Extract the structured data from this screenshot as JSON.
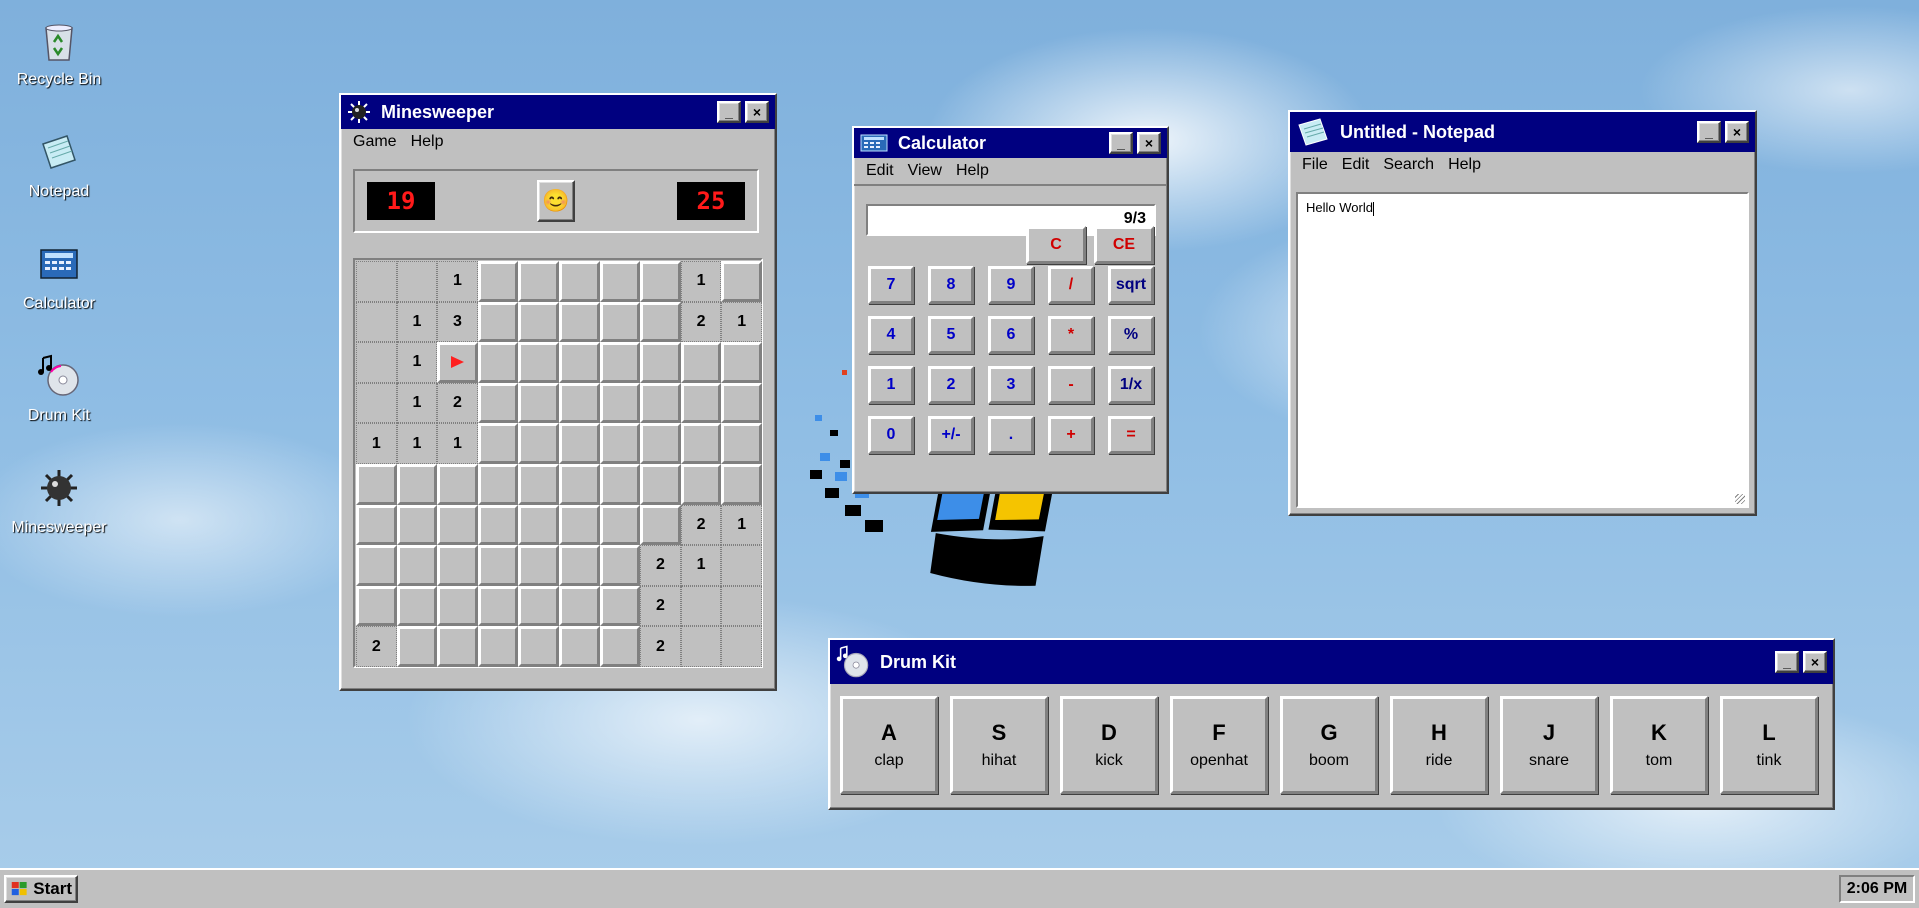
{
  "desktop": {
    "icons": [
      {
        "label": "Recycle Bin",
        "icon": "recycle-bin-icon"
      },
      {
        "label": "Notepad",
        "icon": "notepad-icon"
      },
      {
        "label": "Calculator",
        "icon": "calculator-icon"
      },
      {
        "label": "Drum Kit",
        "icon": "drum-kit-icon"
      },
      {
        "label": "Minesweeper",
        "icon": "minesweeper-icon"
      }
    ]
  },
  "minesweeper": {
    "title": "Minesweeper",
    "menu": [
      "Game",
      "Help"
    ],
    "mines_left": "19",
    "timer": "25",
    "face": "😊",
    "board": [
      [
        "o",
        "o",
        "1",
        "c",
        "c",
        "c",
        "c",
        "c",
        "1",
        "c"
      ],
      [
        "o",
        "1",
        "3",
        "c",
        "c",
        "c",
        "c",
        "c",
        "2",
        "1"
      ],
      [
        "o",
        "1",
        "F",
        "c",
        "c",
        "c",
        "c",
        "c",
        "c",
        "c"
      ],
      [
        "o",
        "1",
        "2",
        "c",
        "c",
        "c",
        "c",
        "c",
        "c",
        "c"
      ],
      [
        "1",
        "1",
        "1",
        "c",
        "c",
        "c",
        "c",
        "c",
        "c",
        "c"
      ],
      [
        "c",
        "c",
        "c",
        "c",
        "c",
        "c",
        "c",
        "c",
        "c",
        "c"
      ],
      [
        "c",
        "c",
        "c",
        "c",
        "c",
        "c",
        "c",
        "c",
        "2",
        "1"
      ],
      [
        "c",
        "c",
        "c",
        "c",
        "c",
        "c",
        "c",
        "2",
        "1",
        "o"
      ],
      [
        "c",
        "c",
        "c",
        "c",
        "c",
        "c",
        "c",
        "2",
        "o",
        "o"
      ],
      [
        "2",
        "c",
        "c",
        "c",
        "c",
        "c",
        "c",
        "2",
        "o",
        "o"
      ]
    ]
  },
  "calculator": {
    "title": "Calculator",
    "menu": [
      "Edit",
      "View",
      "Help"
    ],
    "display": "9/3",
    "clear_label": "C",
    "clear_entry_label": "CE",
    "rows": [
      [
        "7",
        "8",
        "9",
        "/",
        "sqrt"
      ],
      [
        "4",
        "5",
        "6",
        "*",
        "%"
      ],
      [
        "1",
        "2",
        "3",
        "-",
        "1/x"
      ],
      [
        "0",
        "+/-",
        ".",
        "+",
        "="
      ]
    ]
  },
  "notepad": {
    "title": "Untitled - Notepad",
    "menu": [
      "File",
      "Edit",
      "Search",
      "Help"
    ],
    "text": "Hello World"
  },
  "drumkit": {
    "title": "Drum Kit",
    "pads": [
      {
        "key": "A",
        "sound": "clap"
      },
      {
        "key": "S",
        "sound": "hihat"
      },
      {
        "key": "D",
        "sound": "kick"
      },
      {
        "key": "F",
        "sound": "openhat"
      },
      {
        "key": "G",
        "sound": "boom"
      },
      {
        "key": "H",
        "sound": "ride"
      },
      {
        "key": "J",
        "sound": "snare"
      },
      {
        "key": "K",
        "sound": "tom"
      },
      {
        "key": "L",
        "sound": "tink"
      }
    ]
  },
  "taskbar": {
    "start_label": "Start",
    "clock": "2:06 PM"
  },
  "colors": {
    "title_active": "#000080",
    "window_face": "#c0c0c0",
    "led_red": "#ff1a1a",
    "calc_digit_blue": "#0000c8",
    "calc_op_red": "#d00000"
  }
}
